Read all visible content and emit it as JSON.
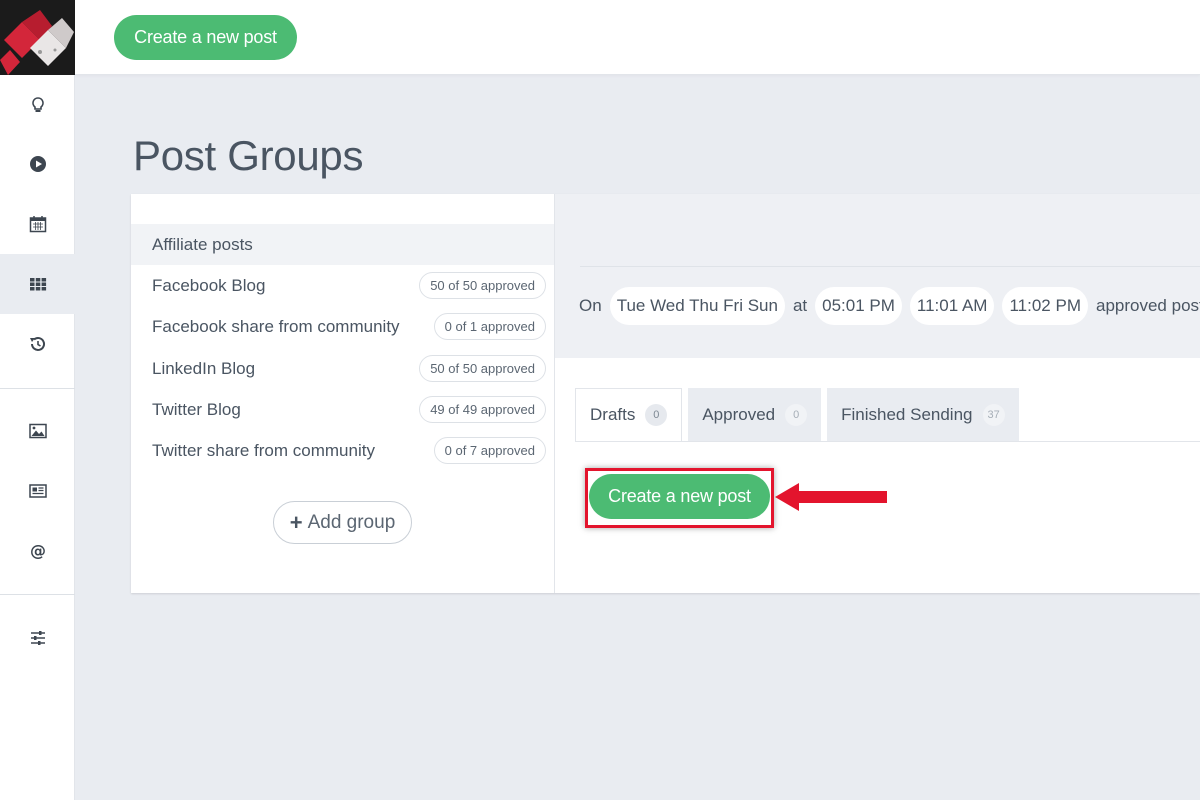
{
  "top_bar": {
    "create_label": "Create a new post"
  },
  "sidebar": {
    "items": [
      {
        "name": "ideas",
        "icon": "lightbulb-icon"
      },
      {
        "name": "play",
        "icon": "play-circle-icon"
      },
      {
        "name": "calendar",
        "icon": "calendar-icon"
      },
      {
        "name": "post-groups",
        "icon": "grid-icon",
        "active": true
      },
      {
        "name": "history",
        "icon": "history-icon"
      },
      {
        "name": "media",
        "icon": "image-icon"
      },
      {
        "name": "content",
        "icon": "newspaper-icon"
      },
      {
        "name": "mentions",
        "icon": "at-icon"
      },
      {
        "name": "settings",
        "icon": "sliders-icon"
      }
    ]
  },
  "page": {
    "title": "Post Groups"
  },
  "groups": [
    {
      "name": "Affiliate posts",
      "badge": ""
    },
    {
      "name": "Facebook Blog",
      "badge": "50 of 50 approved"
    },
    {
      "name": "Facebook share from community",
      "badge": "0 of 1 approved"
    },
    {
      "name": "LinkedIn Blog",
      "badge": "50 of 50 approved"
    },
    {
      "name": "Twitter Blog",
      "badge": "49 of 49 approved"
    },
    {
      "name": "Twitter share from community",
      "badge": "0 of 7 approved"
    }
  ],
  "add_group_label": "Add group",
  "schedule": {
    "on": "On",
    "days": "Tue Wed Thu Fri Sun",
    "at": "at",
    "times": [
      "05:01 PM",
      "11:01 AM",
      "11:02 PM"
    ],
    "suffix": "approved posts will"
  },
  "tabs": [
    {
      "label": "Drafts",
      "count": "0"
    },
    {
      "label": "Approved",
      "count": "0"
    },
    {
      "label": "Finished Sending",
      "count": "37"
    }
  ],
  "main": {
    "create_label": "Create a new post"
  },
  "colors": {
    "accent_green": "#4cbb73",
    "highlight_red": "#e3142d",
    "background": "#e9ecf1"
  }
}
